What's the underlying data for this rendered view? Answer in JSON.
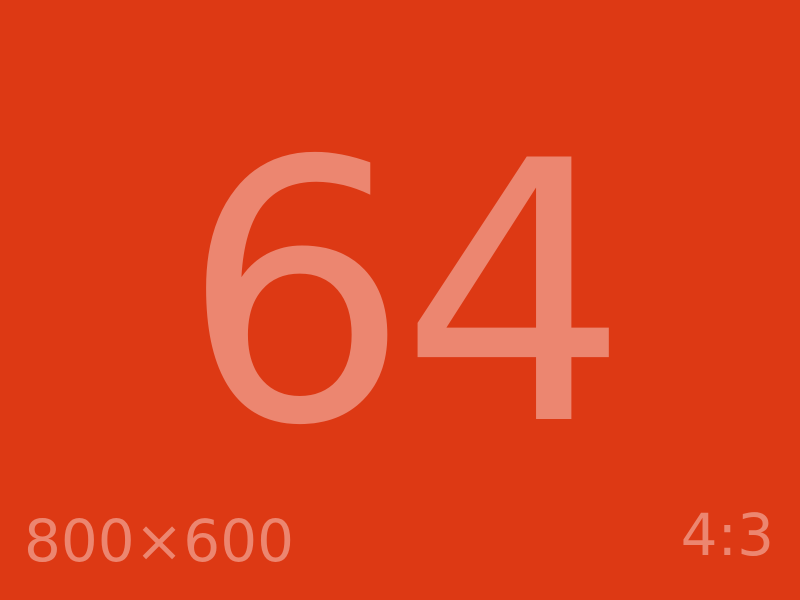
{
  "main_number": "64",
  "dimensions": "800×600",
  "aspect_ratio": "4:3",
  "colors": {
    "background": "#dd3914",
    "text": "#ec8670"
  }
}
